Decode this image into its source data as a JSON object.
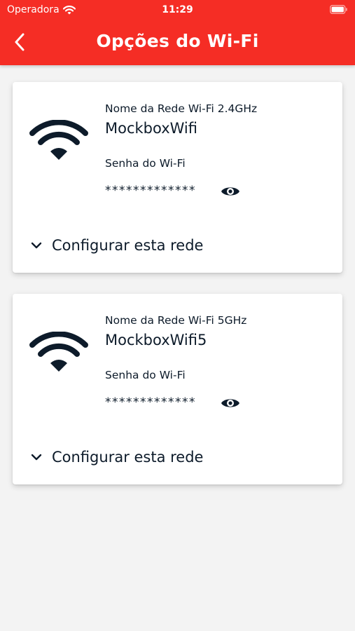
{
  "status_bar": {
    "carrier": "Operadora",
    "time": "11:29"
  },
  "header": {
    "title": "Opções do Wi-Fi",
    "back_icon": "chevron-left-icon"
  },
  "colors": {
    "primary_red": "#f52d25",
    "text_dark": "#0d1b2a",
    "background": "#f3f3f3",
    "card": "#ffffff"
  },
  "networks": [
    {
      "ssid_label": "Nome da Rede Wi-Fi 2.4GHz",
      "ssid": "MockboxWifi",
      "password_label": "Senha do Wi-Fi",
      "password_masked": "*************",
      "configure_label": "Configurar esta rede"
    },
    {
      "ssid_label": "Nome da Rede Wi-Fi 5GHz",
      "ssid": "MockboxWifi5",
      "password_label": "Senha do Wi-Fi",
      "password_masked": "*************",
      "configure_label": "Configurar esta rede"
    }
  ]
}
